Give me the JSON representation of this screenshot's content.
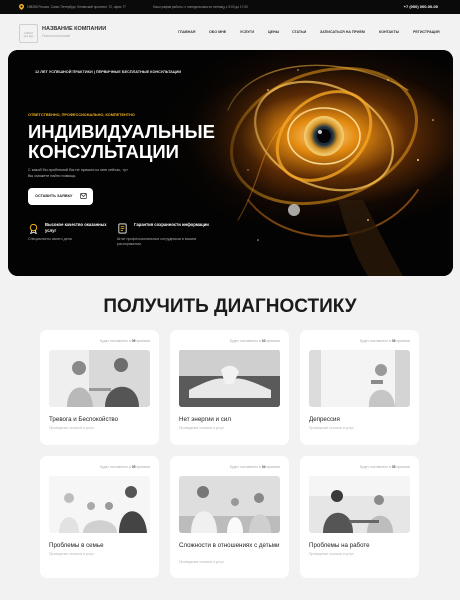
{
  "topbar": {
    "address": "198265 Россия, Санкт-Петербург, Ленинский проспект, 70, офис 77",
    "hours": "Наш график работы: с понедельника по пятницу с 9:00 до 17:00",
    "phone": "+7 (000) 000-00-00"
  },
  "header": {
    "logo_text": "LOGO",
    "logo_sub": "your logo",
    "company_name": "НАЗВАНИЕ КОМПАНИИ",
    "company_sub": "Психологический",
    "nav": [
      "ГЛАВНАЯ",
      "ОБО МНЕ",
      "УСЛУГИ",
      "ЦЕНЫ",
      "СТАТЬИ",
      "ЗАПИСАТЬСЯ НА ПРИЕМ",
      "КОНТАКТЫ",
      "РЕГИСТРАЦИЯ"
    ]
  },
  "hero": {
    "years": "12 ЛЕТ УСПЕШНОЙ ПРАКТИКИ | ПЕРВИЧНЫЕ БЕСПЛАТНЫЕ КОНСУЛЬТАЦИИ",
    "tag": "ОТВЕТСТВЕННО, ПРОФЕССИОНАЛЬНО, КОМПЕТЕНТНО",
    "title_line1": "ИНДИВИДУАЛЬНЫЕ",
    "title_line2": "КОНСУЛЬТАЦИИ",
    "description": "С какой бы проблемой Вы не пришли ко мне сейчас, тут Вы сможете найти помощь",
    "cta_label": "ОСТАВИТЬ ЗАЯВКУ",
    "features": [
      {
        "title": "Высокое качество оказанных услуг",
        "desc": "Специалисты своего дела",
        "icon": "medal-icon"
      },
      {
        "title": "Гарантия сохранности информации",
        "desc": "Штат профессиональных сотрудников в вашем распоряжении",
        "icon": "document-icon"
      }
    ]
  },
  "section_title": "ПОЛУЧИТЬ ДИАГНОСТИКУ",
  "count_prefix": "Будет поставлено в",
  "count_suffix": "приемов",
  "cards": [
    {
      "count": "05",
      "title": "Тревога и Беспокойство",
      "subtitle": "Проведение сеансов и услуг"
    },
    {
      "count": "03",
      "title": "Нет энергии и сил",
      "subtitle": "Проведение сеансов и услуг"
    },
    {
      "count": "05",
      "title": "Депрессия",
      "subtitle": "Проведение сеансов и услуг"
    },
    {
      "count": "05",
      "title": "Проблемы в семье",
      "subtitle": "Проведение сеансов и услуг"
    },
    {
      "count": "04",
      "title": "Сложности в отношениях с детьми",
      "subtitle": "Проведение сеансов и услуг"
    },
    {
      "count": "05",
      "title": "Проблемы на работе",
      "subtitle": "Проведение сеансов и услуг"
    }
  ]
}
